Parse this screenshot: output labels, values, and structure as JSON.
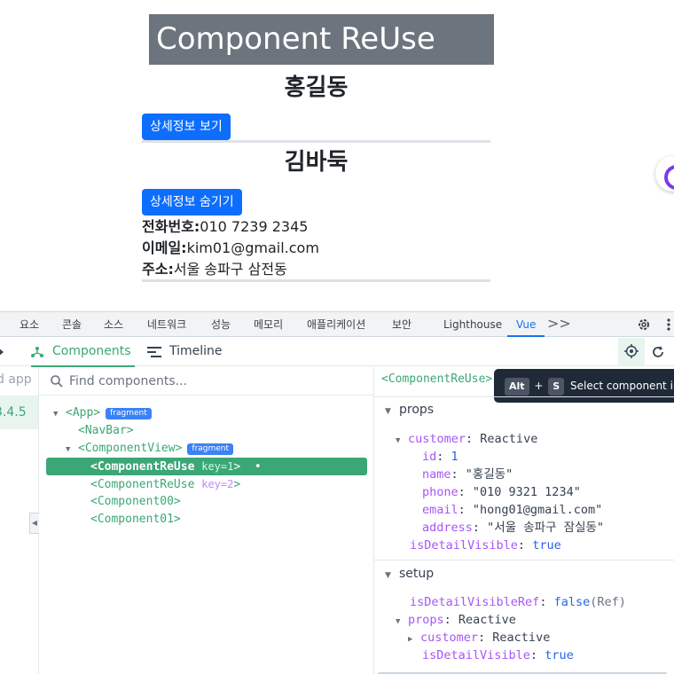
{
  "page": {
    "banner_title": "Component ReUse",
    "customers": [
      {
        "name": "홍길동",
        "button_label": "상세정보 보기"
      },
      {
        "name": "김바둑",
        "button_label": "상세정보 숨기기"
      }
    ],
    "details": {
      "phone_label": "전화번호:",
      "phone_value": "010 7239 2345",
      "email_label": "이메일:",
      "email_value": "kim01@gmail.com",
      "address_label": "주소:",
      "address_value": "서울 송파구 삼전동"
    }
  },
  "devtools": {
    "tabs": [
      "요소",
      "콘솔",
      "소스",
      "네트워크",
      "성능",
      "메모리",
      "애플리케이션",
      "보안",
      "Lighthouse",
      "Vue"
    ],
    "active_tab": "Vue",
    "more_label": ">>",
    "vue_tabs": {
      "components": "Components",
      "timeline": "Timeline"
    },
    "left_pane": {
      "app_label": "d app",
      "version": "3.4.5"
    },
    "search_placeholder": "Find components...",
    "tree": [
      {
        "tag": "<App>",
        "badge": "fragment"
      },
      {
        "tag": "<NavBar>"
      },
      {
        "tag": "<ComponentView>",
        "badge": "fragment"
      },
      {
        "tag": "<ComponentReUse",
        "key": "key=1",
        "close": ">",
        "dot": "•"
      },
      {
        "tag": "<ComponentReUse",
        "key": "key=2",
        "close": ">"
      },
      {
        "tag": "<Component00>"
      },
      {
        "tag": "<Component01>"
      }
    ],
    "inspector": {
      "selected": "<ComponentReUse>",
      "tooltip": {
        "key1": "Alt",
        "plus": "+",
        "key2": "S",
        "text": "Select component in the"
      },
      "props_title": "props",
      "customer_key": "customer",
      "customer_type": "Reactive",
      "customer": {
        "id_key": "id",
        "id_val": "1",
        "name_key": "name",
        "name_val": "\"홍길동\"",
        "phone_key": "phone",
        "phone_val": "\"010 9321 1234\"",
        "email_key": "email",
        "email_val": "\"hong01@gmail.com\"",
        "address_key": "address",
        "address_val": "\"서울 송파구 잠실동\""
      },
      "detail_key": "isDetailVisible",
      "detail_val": "true",
      "setup_title": "setup",
      "setup": {
        "ref_key": "isDetailVisibleRef",
        "ref_val": "false",
        "ref_type": "(Ref)",
        "props_key": "props",
        "props_type": "Reactive",
        "customer_key": "customer",
        "customer_type": "Reactive",
        "detail_key": "isDetailVisible",
        "detail_val": "true"
      }
    }
  },
  "colors": {
    "vue_green": "#3ba776",
    "bootstrap_blue": "#0d6efd",
    "banner_gray": "#6c757d"
  }
}
